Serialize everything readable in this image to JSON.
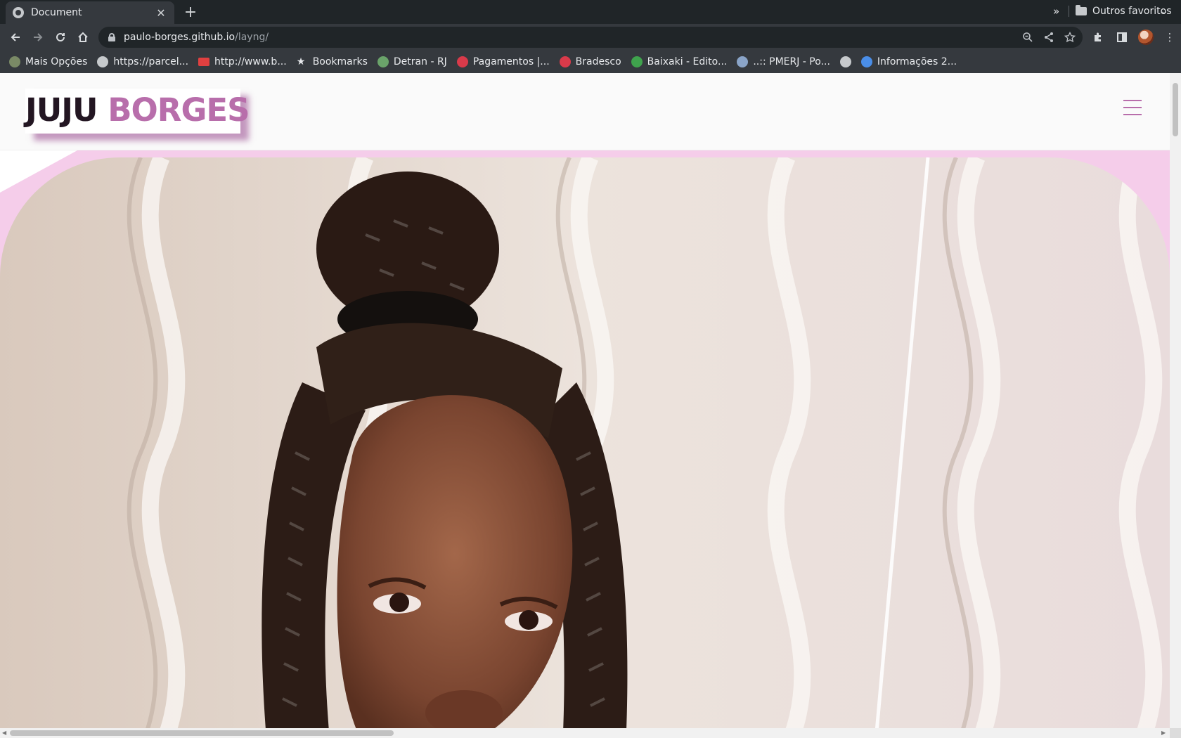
{
  "browser": {
    "tab": {
      "title": "Document"
    },
    "url": {
      "host": "paulo-borges.github.io",
      "path": "/layng/"
    },
    "bookmarks": [
      {
        "label": "Mais Opções",
        "icon": "site-icon",
        "color": "#7a8a66"
      },
      {
        "label": "https://parcel...",
        "icon": "globe-icon",
        "color": "#c6c9cc"
      },
      {
        "label": "http://www.b...",
        "icon": "mail-icon",
        "color": "#e04040"
      },
      {
        "label": "Bookmarks",
        "icon": "star-icon",
        "color": "#e8eaed"
      },
      {
        "label": "Detran - RJ",
        "icon": "badge-icon",
        "color": "#6aa36a"
      },
      {
        "label": "Pagamentos |...",
        "icon": "bank-icon",
        "color": "#d93a4a"
      },
      {
        "label": "Bradesco",
        "icon": "bank-icon",
        "color": "#d93a4a"
      },
      {
        "label": "Baixaki - Edito...",
        "icon": "download-icon",
        "color": "#3fa34d"
      },
      {
        "label": "..:: PMERJ - Po...",
        "icon": "shield-icon",
        "color": "#8aa4c8"
      },
      {
        "label": "",
        "icon": "globe-icon",
        "color": "#c6c9cc"
      },
      {
        "label": "Informações 2...",
        "icon": "dots-icon",
        "color": "#4a8ee8"
      }
    ],
    "bookmarks_more": "»",
    "other_bookmarks": "Outros favoritos"
  },
  "site": {
    "logo_part1": "JUJU",
    "logo_part2": "BORGES"
  },
  "colors": {
    "brand_dark": "#231622",
    "brand_pink": "#b86eab",
    "hero_bg": "#f5cdea"
  }
}
